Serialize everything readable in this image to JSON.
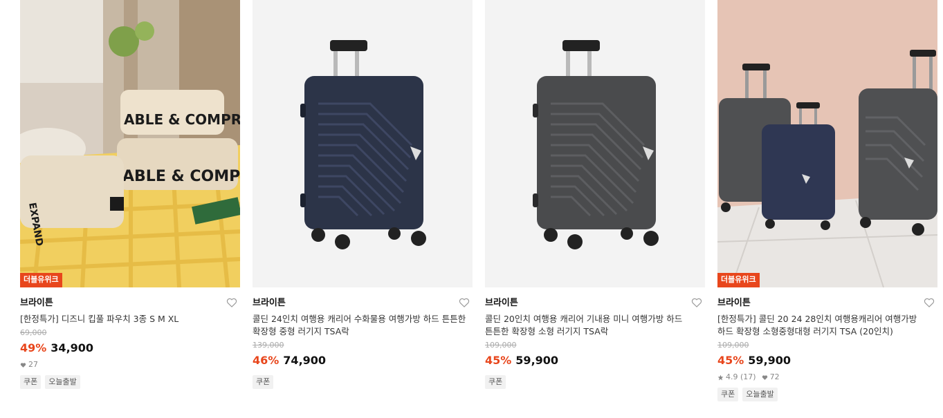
{
  "products": [
    {
      "badge": "더블유위크",
      "brand": "브라이튼",
      "title": "[한정특가] 디즈니 킵풀 파우치 3종 S M XL",
      "original_price": "69,000",
      "discount": "49%",
      "price": "34,900",
      "likes": "27",
      "tags": [
        "쿠폰",
        "오늘출발"
      ],
      "image_icon": "packing-pouch-photo"
    },
    {
      "brand": "브라이튼",
      "title": "콜딘 24인치 여행용 캐리어 수화물용 여행가방 하드 튼튼한 확장형 중형 러기지 TSA락",
      "original_price": "139,000",
      "discount": "46%",
      "price": "74,900",
      "tags": [
        "쿠폰"
      ],
      "image_icon": "navy-suitcase-photo",
      "color": "#2c3448"
    },
    {
      "brand": "브라이튼",
      "title": "콜딘 20인치 여행용 캐리어 기내용 미니 여행가방 하드 튼튼한 확장형 소형 러기지 TSA락",
      "original_price": "109,000",
      "discount": "45%",
      "price": "59,900",
      "tags": [
        "쿠폰"
      ],
      "image_icon": "gray-suitcase-photo",
      "color": "#4a4b4d"
    },
    {
      "badge": "더블유위크",
      "brand": "브라이튼",
      "title": "[한정특가] 콜딘 20 24 28인치 여행용캐리어 여행가방 하드 확장형 소형중형대형 러기지 TSA (20인치)",
      "original_price": "109,000",
      "discount": "45%",
      "price": "59,900",
      "rating": "4.9 (17)",
      "likes": "72",
      "tags": [
        "쿠폰",
        "오늘출발"
      ],
      "image_icon": "suitcase-set-photo"
    }
  ],
  "colors": {
    "accent": "#e8461c",
    "muted": "#888888"
  }
}
